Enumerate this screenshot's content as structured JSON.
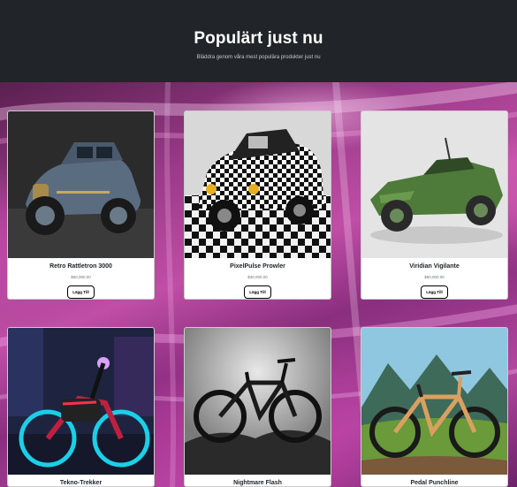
{
  "header": {
    "title": "Populärt just nu",
    "subtitle": "Bläddra genom våra mest populära produkter just nu"
  },
  "products": [
    {
      "name": "Retro Rattletron 3000",
      "price": "$50,000.00",
      "button": "Lägg Till"
    },
    {
      "name": "PixelPulse Prowler",
      "price": "$30,000.00",
      "button": "Lägg Till"
    },
    {
      "name": "Viridian Vigilante",
      "price": "$60,000.00",
      "button": "Lägg Till"
    },
    {
      "name": "Tekno-Trekker"
    },
    {
      "name": "Nightmare Flash"
    },
    {
      "name": "Pedal Punchline"
    }
  ]
}
